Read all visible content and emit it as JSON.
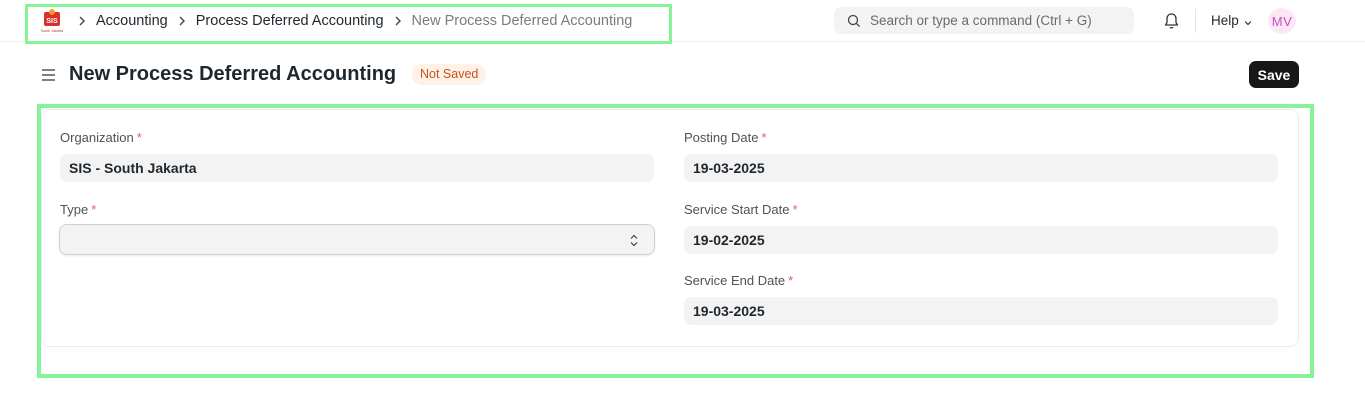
{
  "breadcrumbs": [
    "Accounting",
    "Process Deferred Accounting",
    "New Process Deferred Accounting"
  ],
  "logo": {
    "text": "SIS",
    "caption": "South Jakarta",
    "color": "#d9302b"
  },
  "search": {
    "placeholder": "Search or type a command (Ctrl + G)"
  },
  "navbar": {
    "help_label": "Help",
    "avatar_initials": "MV"
  },
  "page": {
    "title": "New Process Deferred Accounting",
    "status_badge": "Not Saved",
    "save_label": "Save"
  },
  "form": {
    "organization": {
      "label": "Organization",
      "required_mark": "*",
      "value": "SIS - South Jakarta"
    },
    "type": {
      "label": "Type",
      "required_mark": "*",
      "value": ""
    },
    "posting_date": {
      "label": "Posting Date",
      "required_mark": "*",
      "value": "19-03-2025"
    },
    "service_start_date": {
      "label": "Service Start Date",
      "required_mark": "*",
      "value": "19-02-2025"
    },
    "service_end_date": {
      "label": "Service End Date",
      "required_mark": "*",
      "value": "19-03-2025"
    }
  },
  "colors": {
    "highlight": "#86f29a",
    "badge_text": "#c0571b",
    "badge_bg": "#fff1e8",
    "required": "#e55b5b",
    "primary_button": "#171717"
  },
  "icons": [
    "logo-icon",
    "chevron-right-icon",
    "search-icon",
    "bell-icon",
    "chevron-down-icon",
    "hamburger-icon",
    "select-updown-icon"
  ]
}
